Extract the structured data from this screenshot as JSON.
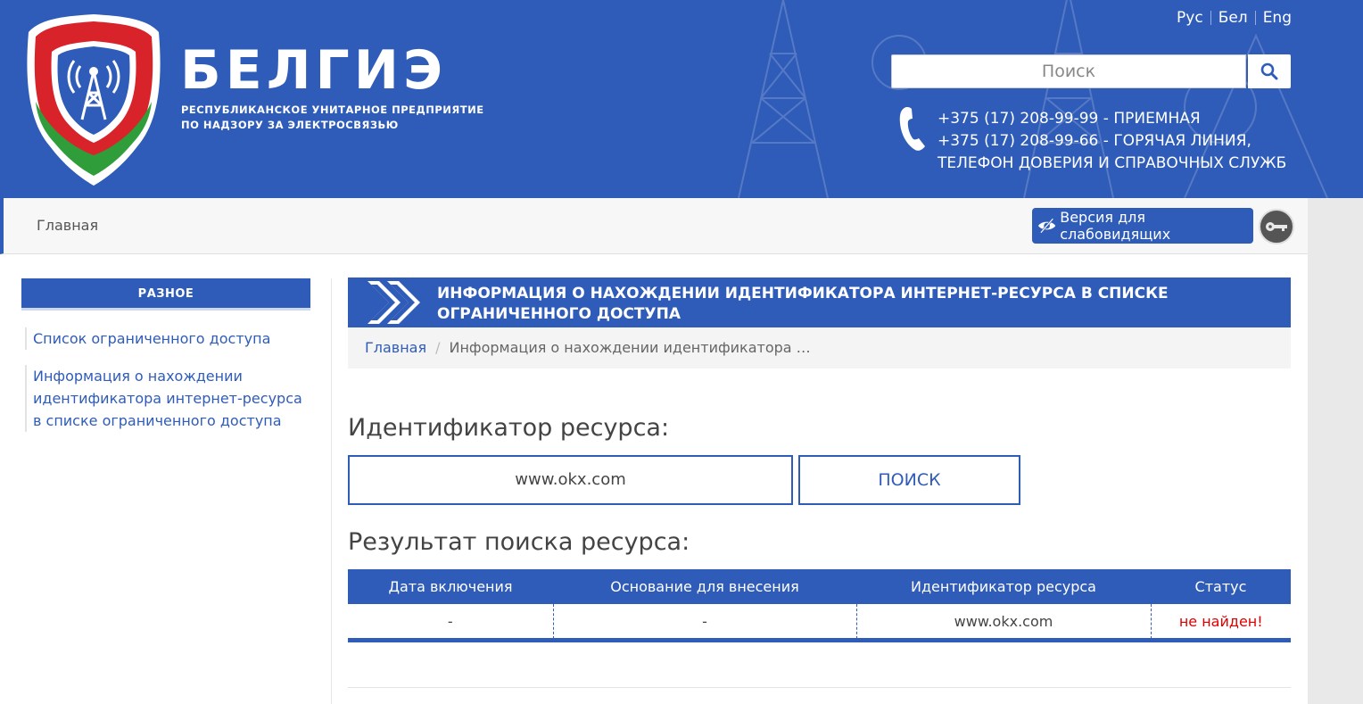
{
  "header": {
    "brand": "БЕЛГИЭ",
    "brand_sub_line1": "Республиканское унитарное предприятие",
    "brand_sub_line2": "по надзору за электросвязью",
    "languages": [
      "Рус",
      "Бел",
      "Eng"
    ],
    "search_placeholder": "Поиск",
    "phones": [
      "+375 (17) 208-99-99 - ПРИЕМНАЯ",
      "+375 (17) 208-99-66 - ГОРЯЧАЯ ЛИНИЯ,",
      "ТЕЛЕФОН ДОВЕРИЯ И СПРАВОЧНЫХ СЛУЖБ"
    ]
  },
  "navbar": {
    "home": "Главная",
    "vision_label": "Версия для слабовидящих"
  },
  "sidebar": {
    "heading": "Разное",
    "items": [
      "Список ограниченного доступа",
      "Информация о нахождении идентификатора интернет-ресурса в списке ограниченного доступа"
    ]
  },
  "main": {
    "title": "Информация о нахождении идентификатора интернет-ресурса в списке ограниченного доступа",
    "breadcrumb": {
      "home": "Главная",
      "separator": "/",
      "current": "Информация о нахождении идентификатора …"
    },
    "id_heading": "Идентификатор ресурса:",
    "id_value": "www.okx.com",
    "search_button": "ПОИСК",
    "result_heading": "Результат поиска ресурса:",
    "table": {
      "headers": [
        "Дата включения",
        "Основание для внесения",
        "Идентификатор ресурса",
        "Статус"
      ],
      "rows": [
        [
          "-",
          "-",
          "www.okx.com",
          "не найден!"
        ]
      ]
    }
  },
  "colors": {
    "brand_blue": "#2f5cb8",
    "status_not_found": "#e00000"
  }
}
